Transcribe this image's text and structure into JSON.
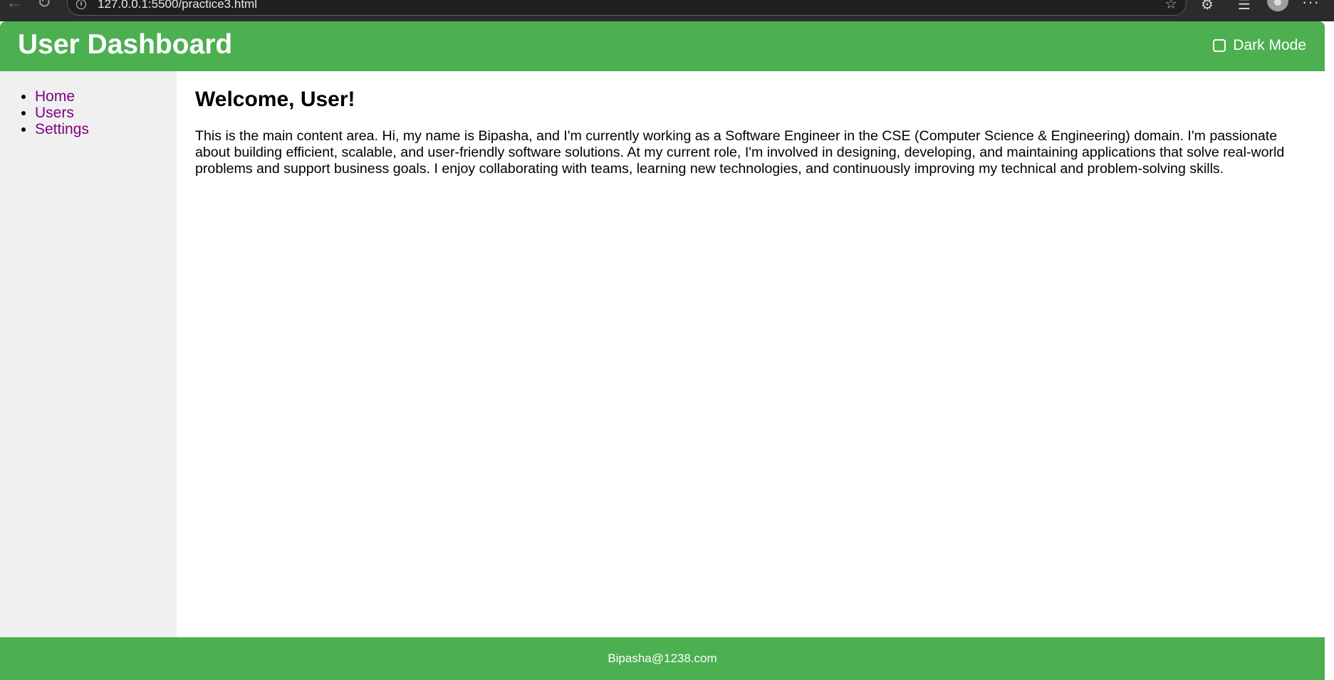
{
  "browser": {
    "url": "127.0.0.1:5500/practice3.html",
    "icons": [
      "back-arrow-icon",
      "reload-icon",
      "info-icon",
      "star-icon",
      "extensions-icon",
      "favorites-icon",
      "profile-icon",
      "more-menu-icon"
    ]
  },
  "header": {
    "title": "User Dashboard",
    "dark_mode_label": "Dark Mode",
    "dark_mode_checked": false,
    "background_color": "#4caf50"
  },
  "sidebar": {
    "items": [
      {
        "label": "Home"
      },
      {
        "label": "Users"
      },
      {
        "label": "Settings"
      }
    ],
    "link_color": "#800080"
  },
  "main": {
    "heading": "Welcome, User!",
    "paragraph": "This is the main content area. Hi, my name is Bipasha, and I'm currently working as a Software Engineer in the CSE (Computer Science & Engineering) domain. I'm passionate about building efficient, scalable, and user-friendly software solutions. At my current role, I'm involved in designing, developing, and maintaining applications that solve real-world problems and support business goals. I enjoy collaborating with teams, learning new technologies, and continuously improving my technical and problem-solving skills."
  },
  "footer": {
    "text": "Bipasha@1238.com"
  }
}
